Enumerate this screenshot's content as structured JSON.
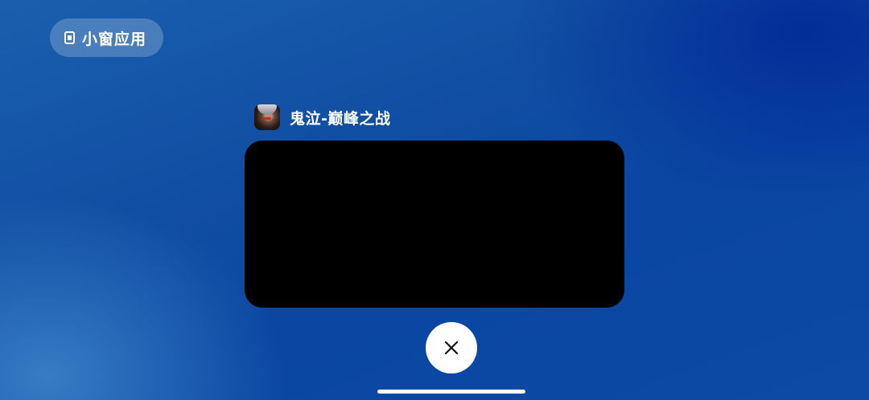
{
  "floating_window_pill": {
    "label": "小窗应用",
    "icon": "small-window-icon"
  },
  "recent_app": {
    "title": "鬼泣-巅峰之战",
    "icon": "devil-may-cry-app-icon"
  },
  "close_button": {
    "icon": "close-icon"
  },
  "colors": {
    "background": "#0f4ea6",
    "pill_bg": "rgba(255,255,255,0.22)",
    "preview_bg": "#000000",
    "close_bg": "#ffffff",
    "text": "#ffffff"
  }
}
